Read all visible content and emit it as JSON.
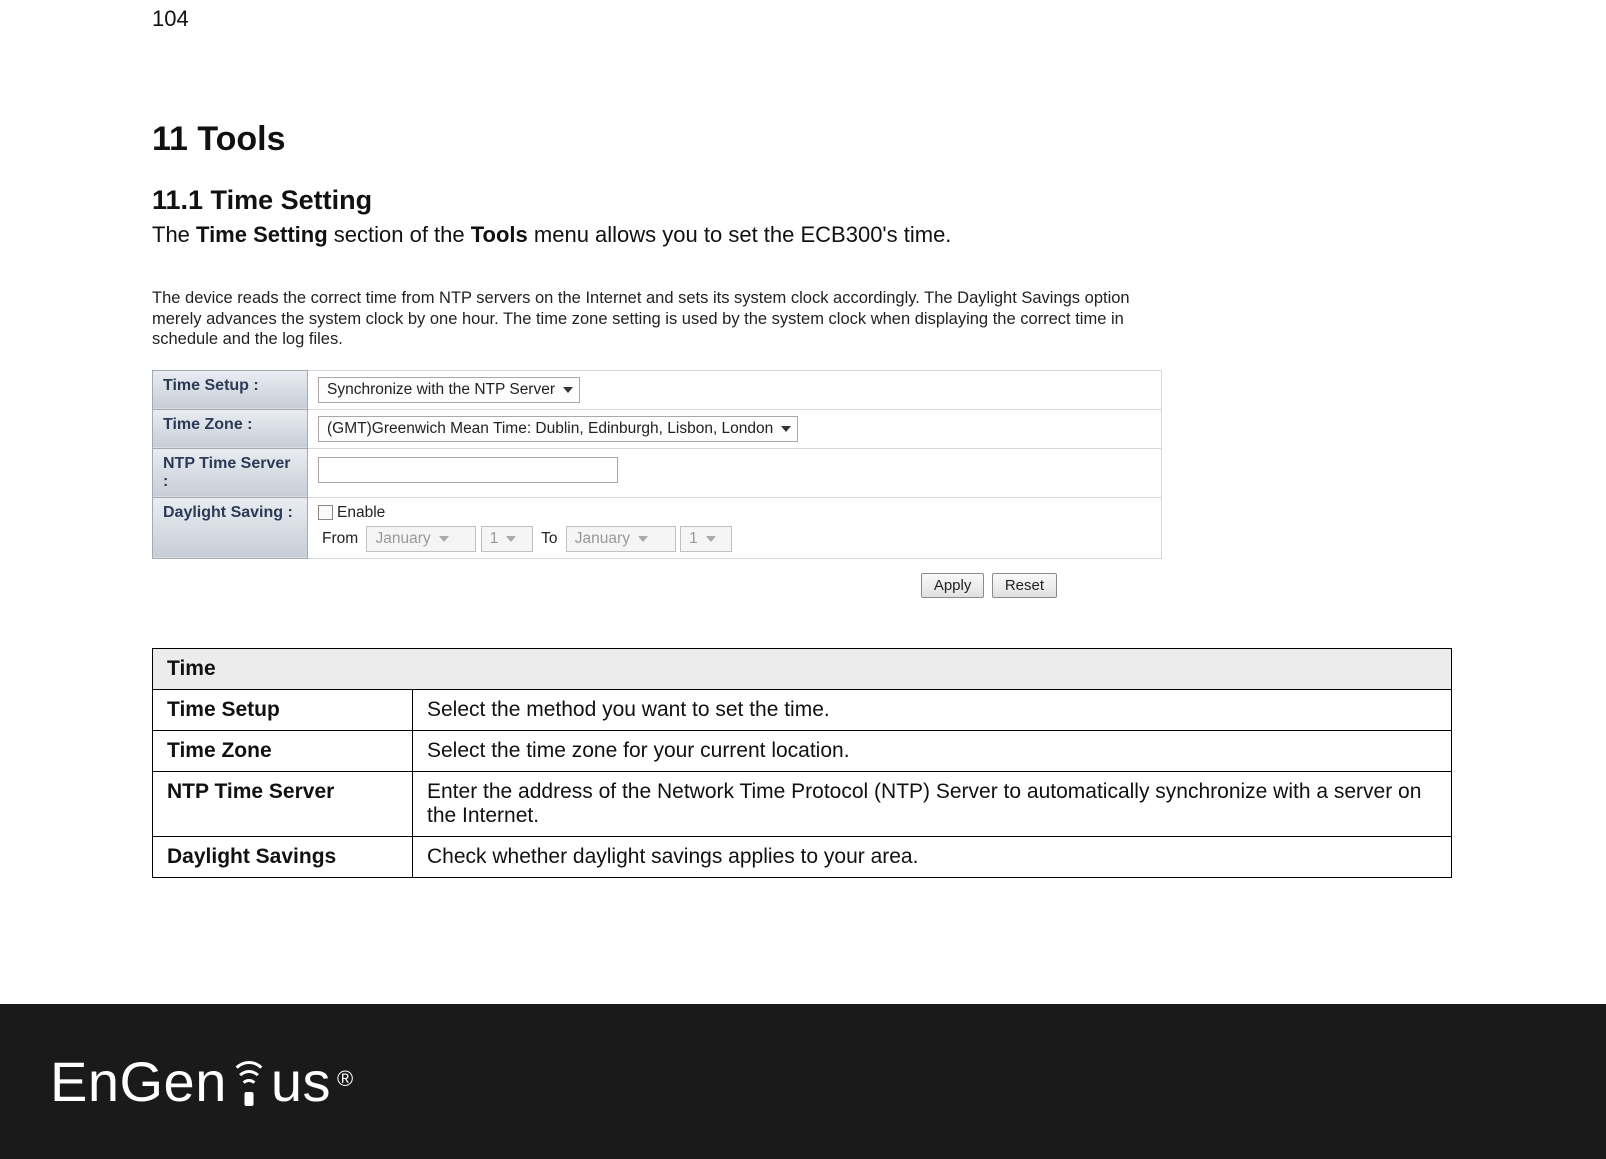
{
  "page_number": "104",
  "headings": {
    "h1": "11 Tools",
    "h2": "11.1 Time Setting"
  },
  "intro": {
    "prefix": "The ",
    "bold1": "Time Setting",
    "mid": " section of the ",
    "bold2": "Tools",
    "suffix": " menu allows you to set the ECB300's time."
  },
  "screenshot": {
    "description": "The device reads the correct time from NTP servers on the Internet and sets its system clock accordingly. The Daylight Savings option merely advances the system clock by one hour. The time zone setting is used by the system clock when displaying the correct time in schedule and the log files.",
    "rows": {
      "time_setup": {
        "label": "Time Setup :",
        "value": "Synchronize with the NTP Server"
      },
      "time_zone": {
        "label": "Time Zone :",
        "value": "(GMT)Greenwich Mean Time: Dublin, Edinburgh, Lisbon, London"
      },
      "ntp_server": {
        "label": "NTP Time Server :",
        "value": ""
      },
      "daylight": {
        "label": "Daylight Saving :",
        "enable_text": "Enable",
        "from_text": "From",
        "to_text": "To",
        "from_month": "January",
        "from_day": "1",
        "to_month": "January",
        "to_day": "1"
      }
    },
    "buttons": {
      "apply": "Apply",
      "reset": "Reset"
    }
  },
  "desc_table": {
    "header": "Time",
    "rows": [
      {
        "key": "Time Setup",
        "val": "Select the method you want to set the time."
      },
      {
        "key": "Time Zone",
        "val": "Select the time zone for your current location."
      },
      {
        "key": "NTP Time Server",
        "val": "Enter the address of the Network Time Protocol (NTP) Server to automatically synchronize with a server on the Internet."
      },
      {
        "key": "Daylight Savings",
        "val": "Check whether daylight savings applies to your area."
      }
    ]
  },
  "footer": {
    "brand_left": "EnGen",
    "brand_right": "us",
    "reg": "®"
  }
}
